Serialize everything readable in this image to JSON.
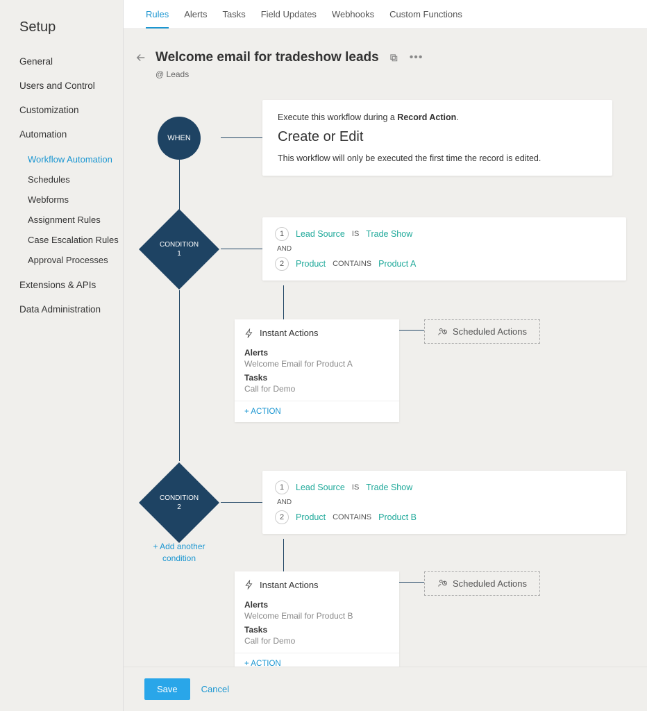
{
  "sidebar": {
    "title": "Setup",
    "sections": [
      {
        "label": "General"
      },
      {
        "label": "Users and Control"
      },
      {
        "label": "Customization"
      },
      {
        "label": "Automation",
        "children": [
          {
            "label": "Workflow Automation",
            "active": true
          },
          {
            "label": "Schedules"
          },
          {
            "label": "Webforms"
          },
          {
            "label": "Assignment Rules"
          },
          {
            "label": "Case Escalation Rules"
          },
          {
            "label": "Approval Processes"
          }
        ]
      },
      {
        "label": "Extensions & APIs"
      },
      {
        "label": "Data Administration"
      }
    ]
  },
  "tabs": [
    {
      "label": "Rules",
      "active": true
    },
    {
      "label": "Alerts"
    },
    {
      "label": "Tasks"
    },
    {
      "label": "Field Updates"
    },
    {
      "label": "Webhooks"
    },
    {
      "label": "Custom Functions"
    }
  ],
  "header": {
    "title": "Welcome email for tradeshow leads",
    "module": "@ Leads"
  },
  "when": {
    "node_label": "WHEN",
    "exec_prefix": "Execute this workflow during a ",
    "exec_bold": "Record Action",
    "exec_suffix": ".",
    "trigger": "Create or Edit",
    "note": "This workflow will only be executed the first time the record is edited."
  },
  "conditions": [
    {
      "node_label_line1": "CONDITION",
      "node_label_line2": "1",
      "rules": [
        {
          "num": "1",
          "field": "Lead Source",
          "op": "IS",
          "val": "Trade Show"
        },
        {
          "num": "2",
          "field": "Product",
          "op": "CONTAINS",
          "val": "Product A"
        }
      ],
      "and_label": "AND",
      "actions": {
        "instant_title": "Instant Actions",
        "alerts_title": "Alerts",
        "alerts_value": "Welcome Email for Product A",
        "tasks_title": "Tasks",
        "tasks_value": "Call for Demo",
        "add_action": "+ ACTION",
        "scheduled": "Scheduled Actions"
      }
    },
    {
      "node_label_line1": "CONDITION",
      "node_label_line2": "2",
      "rules": [
        {
          "num": "1",
          "field": "Lead Source",
          "op": "IS",
          "val": "Trade Show"
        },
        {
          "num": "2",
          "field": "Product",
          "op": "CONTAINS",
          "val": "Product B"
        }
      ],
      "and_label": "AND",
      "actions": {
        "instant_title": "Instant Actions",
        "alerts_title": "Alerts",
        "alerts_value": "Welcome Email for Product B",
        "tasks_title": "Tasks",
        "tasks_value": "Call for Demo",
        "add_action": "+ ACTION",
        "scheduled": "Scheduled Actions"
      }
    }
  ],
  "add_condition": "+ Add another condition",
  "footer": {
    "save": "Save",
    "cancel": "Cancel"
  }
}
